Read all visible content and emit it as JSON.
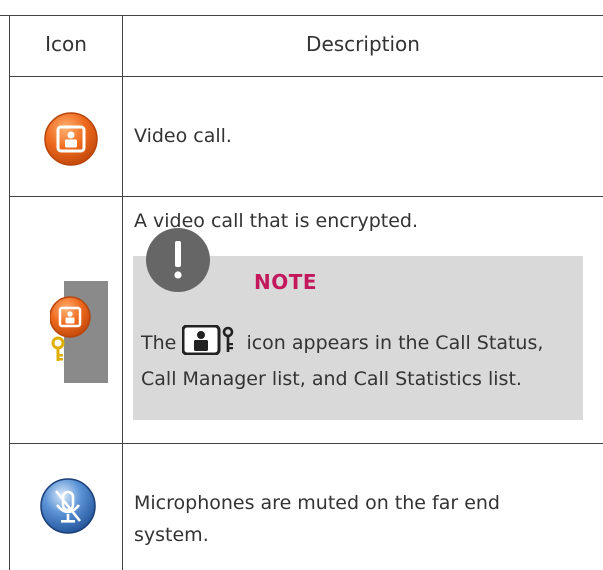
{
  "header": {
    "icon_col": "Icon",
    "desc_col": "Description"
  },
  "rows": [
    {
      "icon": "video-call-icon",
      "description": "Video call."
    },
    {
      "icon": "encrypted-video-call-icon",
      "description": "A video call that is encrypted.",
      "note": {
        "title": "NOTE",
        "text_before": "The",
        "inline_icon": "encrypted-call-inline-icon",
        "text_after_line1": "icon appears in the Call Status,",
        "text_line2": "Call Manager list, and Call Statistics list."
      }
    },
    {
      "icon": "microphone-muted-icon",
      "description_line1": "Microphones are muted on the far end",
      "description_line2": "system."
    }
  ],
  "colors": {
    "note_background": "#d9d9d9",
    "note_title": "#c4185c",
    "video_icon_orange": "#e8651c",
    "mic_icon_blue": "#2c6fb8"
  }
}
